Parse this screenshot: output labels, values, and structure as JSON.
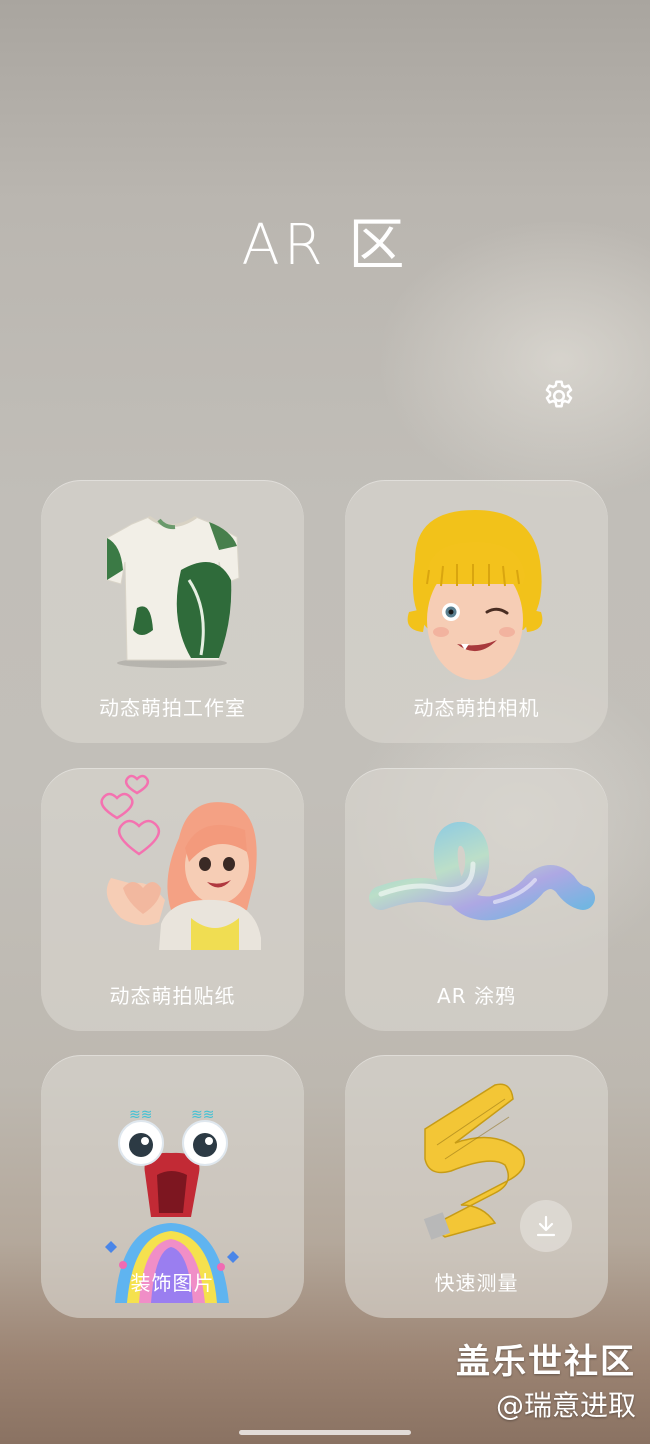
{
  "page": {
    "title": "AR 区",
    "settings_icon": "gear-icon"
  },
  "cards": [
    {
      "label": "动态萌拍工作室",
      "art": "tshirt-image"
    },
    {
      "label": "动态萌拍相机",
      "art": "avatar-wink-image"
    },
    {
      "label": "动态萌拍贴纸",
      "art": "avatar-heart-sticker-image"
    },
    {
      "label": "AR 涂鸦",
      "art": "3d-doodle-image"
    },
    {
      "label": "装饰图片",
      "art": "monster-face-image"
    },
    {
      "label": "快速测量",
      "art": "tape-measure-image",
      "action_icon": "download-icon"
    }
  ],
  "watermark": {
    "line1": "盖乐世社区",
    "line2": "@瑞意进取"
  }
}
